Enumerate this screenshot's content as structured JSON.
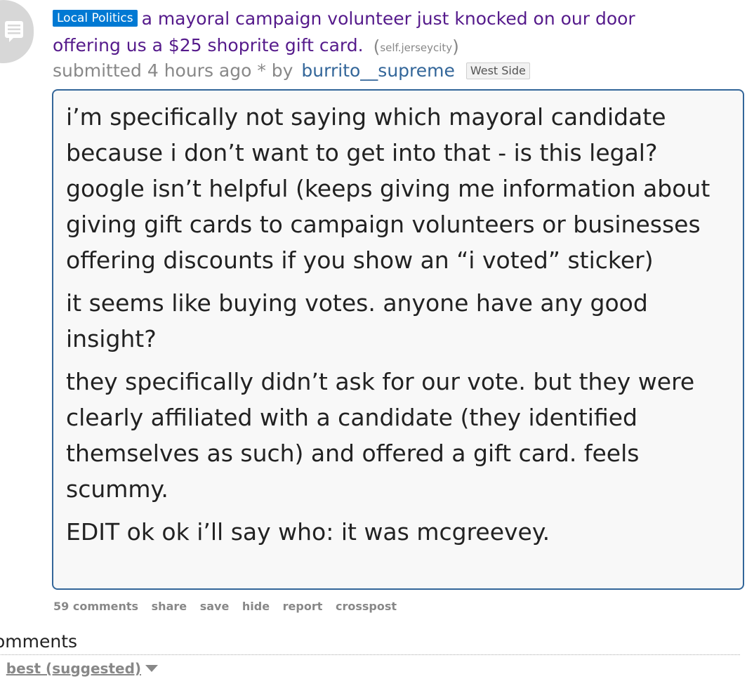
{
  "post": {
    "flair": "Local Politics",
    "title_line1": "a mayoral campaign volunteer just knocked on our door",
    "title_line2": "offering us a $25 shoprite gift card.",
    "domain": "self.jerseycity",
    "submitted": "submitted 4 hours ago * by",
    "author": "burrito__supreme",
    "author_flair": "West Side"
  },
  "selftext": {
    "paragraphs": [
      "i’m specifically not saying which mayoral candidate because i don’t want to get into that - is this legal? google isn’t helpful (keeps giving me information about giving gift cards to campaign volunteers or businesses offering discounts if you show an “i voted” sticker)",
      "it seems like buying votes. anyone have any good insight?",
      "they specifically didn’t ask for our vote. but they were clearly affiliated with a candidate (they identified themselves as such) and offered a gift card. feels scummy.",
      "EDIT ok ok i’ll say who: it was mcgreevey."
    ]
  },
  "buttons": {
    "comments": "59 comments",
    "share": "share",
    "save": "save",
    "hide": "hide",
    "report": "report",
    "crosspost": "crosspost"
  },
  "comments_section": {
    "heading": "omments",
    "sort_prefix": ":",
    "sort_value": "best (suggested)"
  },
  "icons": {
    "thumbnail": "self-post-icon",
    "sort_caret": "caret-down-icon"
  },
  "colors": {
    "flair_bg": "#0079d3",
    "visited_link": "#551a8b",
    "author_link": "#336699",
    "meta_gray": "#888888"
  }
}
